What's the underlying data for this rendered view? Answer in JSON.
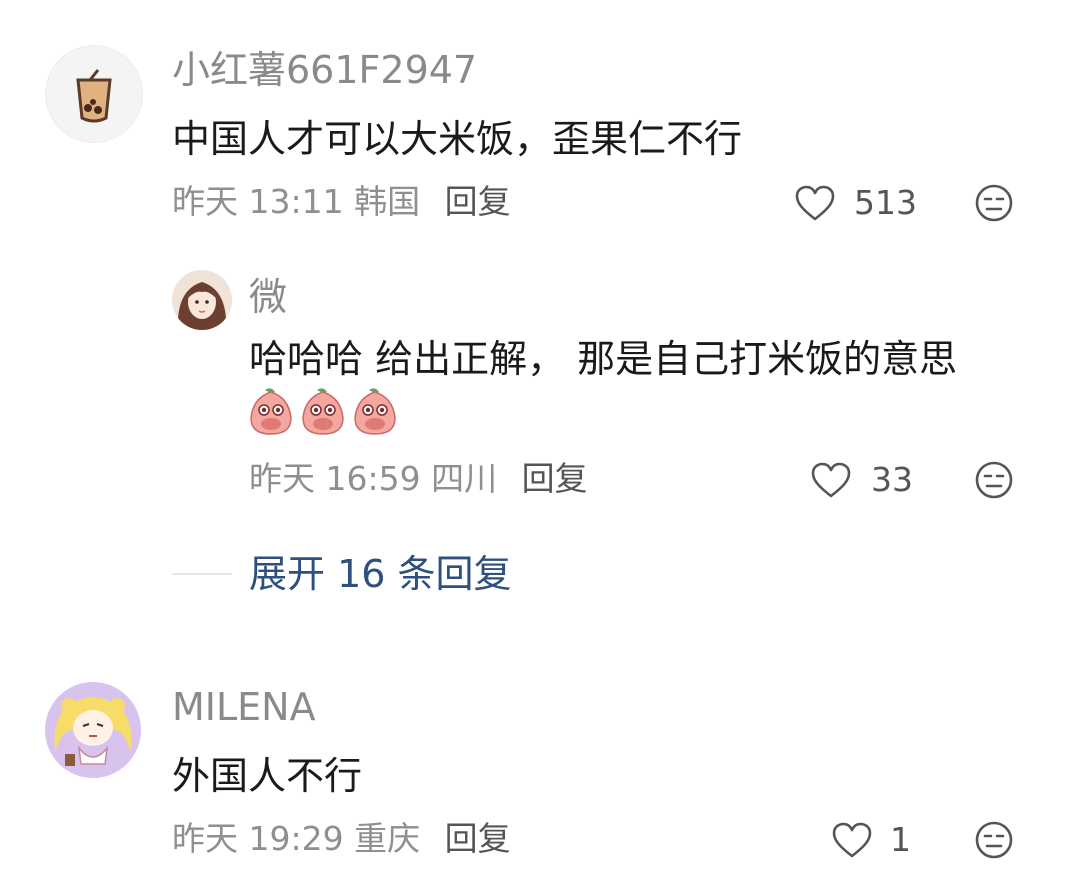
{
  "comments": [
    {
      "username": "小红薯661F2947",
      "text": "中国人才可以大米饭，歪果仁不行",
      "time": "昨天 13:11",
      "location": "韩国",
      "reply_label": "回复",
      "likes": "513"
    },
    {
      "username": "微",
      "text": "哈哈哈 给出正解， 那是自己打米饭的意思",
      "time": "昨天 16:59",
      "location": "四川",
      "reply_label": "回复",
      "likes": "33"
    },
    {
      "username": "MILENA",
      "text": "外国人不行",
      "time": "昨天 19:29",
      "location": "重庆",
      "reply_label": "回复",
      "likes": "1"
    }
  ],
  "expand_replies": "展开 16 条回复",
  "icons": {
    "like": "heart-icon",
    "dislike": "unamused-face-icon",
    "emoji": "peach-emoji"
  },
  "colors": {
    "text": "#1a1a1a",
    "name": "#8a8a8a",
    "meta": "#8f8f8f",
    "link": "#2f4f7f"
  }
}
